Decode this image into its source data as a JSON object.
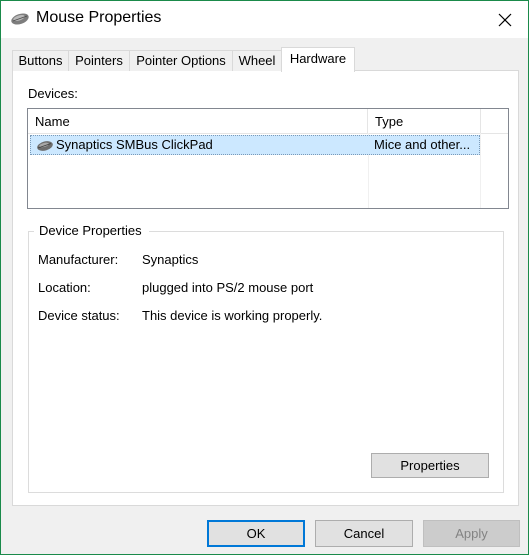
{
  "window": {
    "title": "Mouse Properties",
    "icon": "mouse-icon",
    "close_icon": "close-icon",
    "accent_color": "#1a8a4a"
  },
  "tabs": [
    {
      "label": "Buttons",
      "active": false
    },
    {
      "label": "Pointers",
      "active": false
    },
    {
      "label": "Pointer Options",
      "active": false
    },
    {
      "label": "Wheel",
      "active": false
    },
    {
      "label": "Hardware",
      "active": true
    }
  ],
  "devices": {
    "label": "Devices:",
    "columns": [
      "Name",
      "Type"
    ],
    "rows": [
      {
        "icon": "mouse-icon",
        "name": "Synaptics SMBus ClickPad",
        "type": "Mice and other...",
        "selected": true
      }
    ],
    "selection_color": "#cce8ff"
  },
  "device_properties": {
    "title": "Device Properties",
    "fields": [
      {
        "label": "Manufacturer:",
        "value": "Synaptics"
      },
      {
        "label": "Location:",
        "value": "plugged into PS/2 mouse port"
      },
      {
        "label": "Device status:",
        "value": "This device is working properly."
      }
    ],
    "properties_button": "Properties"
  },
  "footer": {
    "ok_label": "OK",
    "cancel_label": "Cancel",
    "apply_label": "Apply",
    "default_button_color": "#0078d7"
  }
}
